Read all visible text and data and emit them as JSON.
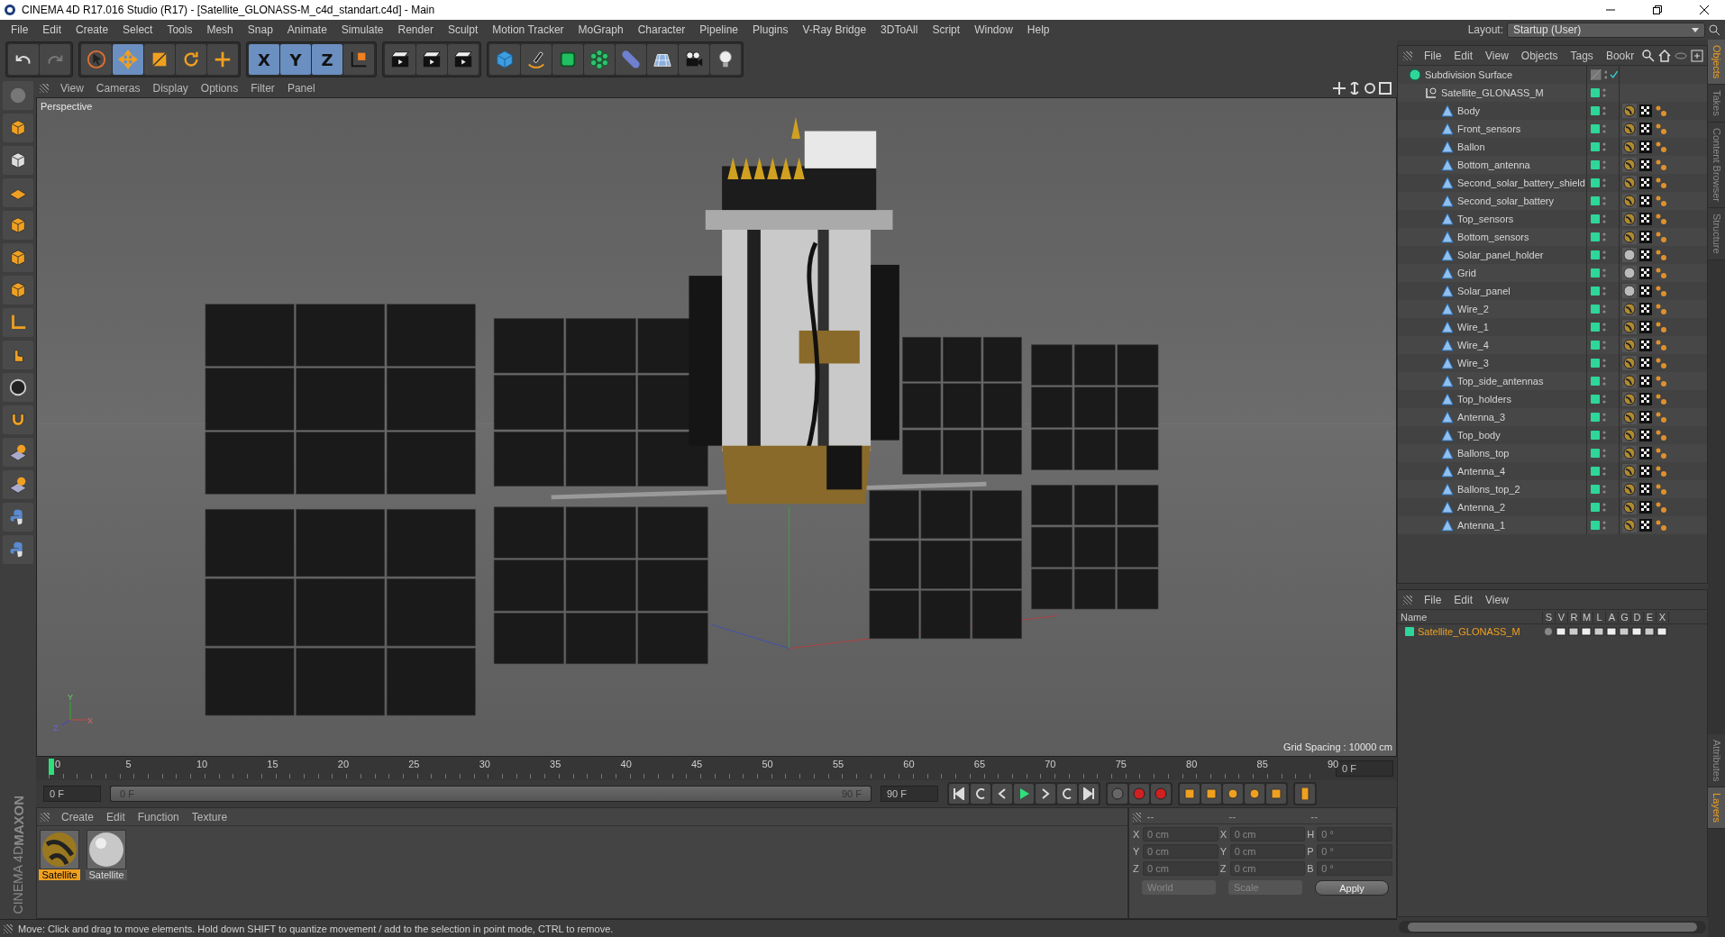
{
  "window": {
    "title": "CINEMA 4D R17.016 Studio (R17) - [Satellite_GLONASS-M_c4d_standart.c4d] - Main"
  },
  "menu": [
    "File",
    "Edit",
    "Create",
    "Select",
    "Tools",
    "Mesh",
    "Snap",
    "Animate",
    "Simulate",
    "Render",
    "Sculpt",
    "Motion Tracker",
    "MoGraph",
    "Character",
    "Pipeline",
    "Plugins",
    "V-Ray Bridge",
    "3DToAll",
    "Script",
    "Window",
    "Help"
  ],
  "layout": {
    "label": "Layout:",
    "value": "Startup (User)"
  },
  "toolbar": {
    "tools": [
      {
        "kind": "select",
        "selected": false
      },
      {
        "kind": "move",
        "selected": true
      },
      {
        "kind": "scale",
        "selected": false
      },
      {
        "kind": "rotate",
        "selected": false
      },
      {
        "kind": "add",
        "selected": false
      }
    ],
    "axes": [
      {
        "label": "X",
        "selected": true
      },
      {
        "label": "Y",
        "selected": true
      },
      {
        "label": "Z",
        "selected": true
      }
    ]
  },
  "viewport": {
    "menu": [
      "View",
      "Cameras",
      "Display",
      "Options",
      "Filter",
      "Panel"
    ],
    "camera": "Perspective",
    "grid_spacing": "Grid Spacing : 10000 cm",
    "gizmo": [
      "Y",
      "Z",
      "X"
    ]
  },
  "timeline": {
    "ticks": [
      "0",
      "5",
      "10",
      "15",
      "20",
      "25",
      "30",
      "35",
      "40",
      "45",
      "50",
      "55",
      "60",
      "65",
      "70",
      "75",
      "80",
      "85",
      "90"
    ],
    "current": "0 F",
    "start": "0 F",
    "range": {
      "start": "0 F",
      "end": "90 F",
      "level": 1
    },
    "end": "90 F"
  },
  "materials": {
    "menu": [
      "Create",
      "Edit",
      "Function",
      "Texture"
    ],
    "items": [
      {
        "name": "Satellite",
        "kind": "gold",
        "selected": true
      },
      {
        "name": "Satellite",
        "kind": "plain",
        "selected": false
      }
    ]
  },
  "brand": {
    "top": "MAXON",
    "bottom": "CINEMA 4D"
  },
  "coordinates": {
    "headers": [
      "--",
      "--",
      "--"
    ],
    "columns": [
      [
        {
          "label": "X",
          "value": "0 cm"
        },
        {
          "label": "Y",
          "value": "0 cm"
        },
        {
          "label": "Z",
          "value": "0 cm"
        }
      ],
      [
        {
          "label": "X",
          "value": "0 cm"
        },
        {
          "label": "Y",
          "value": "0 cm"
        },
        {
          "label": "Z",
          "value": "0 cm"
        }
      ],
      [
        {
          "label": "H",
          "value": "0 °"
        },
        {
          "label": "P",
          "value": "0 °"
        },
        {
          "label": "B",
          "value": "0 °"
        }
      ]
    ],
    "mode": "World",
    "scale": "Scale",
    "apply": "Apply"
  },
  "status_bar": "Move: Click and drag to move elements. Hold down SHIFT to quantize movement / add to the selection in point mode, CTRL to remove.",
  "objects": {
    "menu": [
      "File",
      "Edit",
      "View",
      "Objects",
      "Tags",
      "Bookr"
    ],
    "tree": [
      {
        "name": "Subdivision Surface",
        "kind": "subdivision",
        "children": [
          {
            "name": "Satellite_GLONASS_M",
            "kind": "null",
            "children": [
              {
                "name": "Body",
                "kind": "polygon",
                "textured_material": true
              },
              {
                "name": "Front_sensors",
                "kind": "polygon",
                "textured_material": true
              },
              {
                "name": "Ballon",
                "kind": "polygon",
                "textured_material": true
              },
              {
                "name": "Bottom_antenna",
                "kind": "polygon",
                "textured_material": true
              },
              {
                "name": "Second_solar_battery_shield",
                "kind": "polygon",
                "textured_material": true
              },
              {
                "name": "Second_solar_battery",
                "kind": "polygon",
                "textured_material": true
              },
              {
                "name": "Top_sensors",
                "kind": "polygon",
                "textured_material": true
              },
              {
                "name": "Bottom_sensors",
                "kind": "polygon",
                "textured_material": true
              },
              {
                "name": "Solar_panel_holder",
                "kind": "polygon",
                "textured_material": false
              },
              {
                "name": "Grid",
                "kind": "polygon",
                "textured_material": false
              },
              {
                "name": "Solar_panel",
                "kind": "polygon",
                "textured_material": false
              },
              {
                "name": "Wire_2",
                "kind": "polygon",
                "textured_material": true
              },
              {
                "name": "Wire_1",
                "kind": "polygon",
                "textured_material": true
              },
              {
                "name": "Wire_4",
                "kind": "polygon",
                "textured_material": true
              },
              {
                "name": "Wire_3",
                "kind": "polygon",
                "textured_material": true
              },
              {
                "name": "Top_side_antennas",
                "kind": "polygon",
                "textured_material": true
              },
              {
                "name": "Top_holders",
                "kind": "polygon",
                "textured_material": true
              },
              {
                "name": "Antenna_3",
                "kind": "polygon",
                "textured_material": true
              },
              {
                "name": "Top_body",
                "kind": "polygon",
                "textured_material": true
              },
              {
                "name": "Ballons_top",
                "kind": "polygon",
                "textured_material": true
              },
              {
                "name": "Antenna_4",
                "kind": "polygon",
                "textured_material": true
              },
              {
                "name": "Ballons_top_2",
                "kind": "polygon",
                "textured_material": true
              },
              {
                "name": "Antenna_2",
                "kind": "polygon",
                "textured_material": true
              },
              {
                "name": "Antenna_1",
                "kind": "polygon",
                "textured_material": true
              }
            ]
          }
        ]
      }
    ]
  },
  "layers": {
    "menu": [
      "File",
      "Edit",
      "View"
    ],
    "columns": [
      "Name",
      "S",
      "V",
      "R",
      "M",
      "L",
      "A",
      "G",
      "D",
      "E",
      "X"
    ],
    "rows": [
      {
        "name": "Satellite_GLONASS_M"
      }
    ]
  },
  "side_tabs_top": [
    {
      "label": "Objects",
      "selected": true
    },
    {
      "label": "Takes",
      "selected": false
    },
    {
      "label": "Content Browser",
      "selected": false
    },
    {
      "label": "Structure",
      "selected": false
    }
  ],
  "side_tabs_bottom": [
    {
      "label": "Attributes",
      "selected": false
    },
    {
      "label": "Layers",
      "selected": true
    }
  ]
}
